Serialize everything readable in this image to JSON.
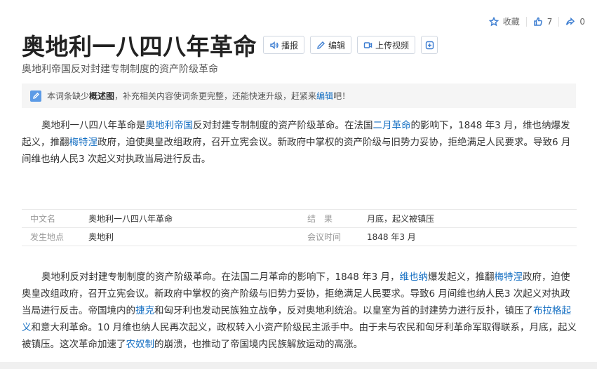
{
  "actions": {
    "collect_label": "收藏",
    "like_count": "7",
    "share_count": "0"
  },
  "title": "奥地利一八四八年革命",
  "buttons": {
    "play": "播报",
    "edit": "编辑",
    "upload_video": "上传视频",
    "add": "+"
  },
  "subtitle": "奥地利帝国反对封建专制制度的资产阶级革命",
  "notice": {
    "pre": "本词条缺少",
    "bold": "概述图",
    "mid": "，补充相关内容使词条更完整，还能快速升级，赶紧来",
    "link": "编辑",
    "post": "吧！"
  },
  "summary": {
    "t1": "奥地利一八四八年革命是",
    "l1": "奥地利帝国",
    "t2": "反对封建专制制度的资产阶级革命。在法国",
    "l2": "二月革命",
    "t3": "的影响下，1848 年3 月，维也纳爆发起义，推翻",
    "l3": "梅特涅",
    "t4": "政府，迫使奥皇改组政府，召开立宪会议。新政府中掌权的资产阶级与旧势力妥协，拒绝满足人民要求。导致6 月间维也纳人民3 次起义对执政当局进行反击。"
  },
  "infobox": {
    "rows": [
      {
        "k1": "中文名",
        "v1": "奥地利一八四八年革命",
        "k2": "结　果",
        "v2": "月底，起义被镇压"
      },
      {
        "k1": "发生地点",
        "v1": "奥地利",
        "k2": "会议时间",
        "v2": "1848 年3 月"
      }
    ]
  },
  "body": {
    "t1": "奥地利反对封建专制制度的资产阶级革命。在法国二月革命的影响下，1848 年3 月，",
    "l1": "维也纳",
    "t2": "爆发起义，推翻",
    "l2": "梅特涅",
    "t3": "政府，迫使奥皇改组政府，召开立宪会议。新政府中掌权的资产阶级与旧势力妥协，拒绝满足人民要求。导致6 月间维也纳人民3 次起义对执政当局进行反击。帝国境内的",
    "l3": "捷克",
    "t4": "和匈牙利也发动民族独立战争，反对奥地利统治。以皇室为首的封建势力进行反扑，镇压了",
    "l4": "布拉格起义",
    "t5": "和意大利革命。10 月维也纳人民再次起义，政权转入小资产阶级民主派手中。由于未与农民和匈牙利革命军取得联系，月底，起义被镇压。这次革命加速了",
    "l5": "农奴制",
    "t6": "的崩溃，也推动了帝国境内民族解放运动的高涨。"
  }
}
